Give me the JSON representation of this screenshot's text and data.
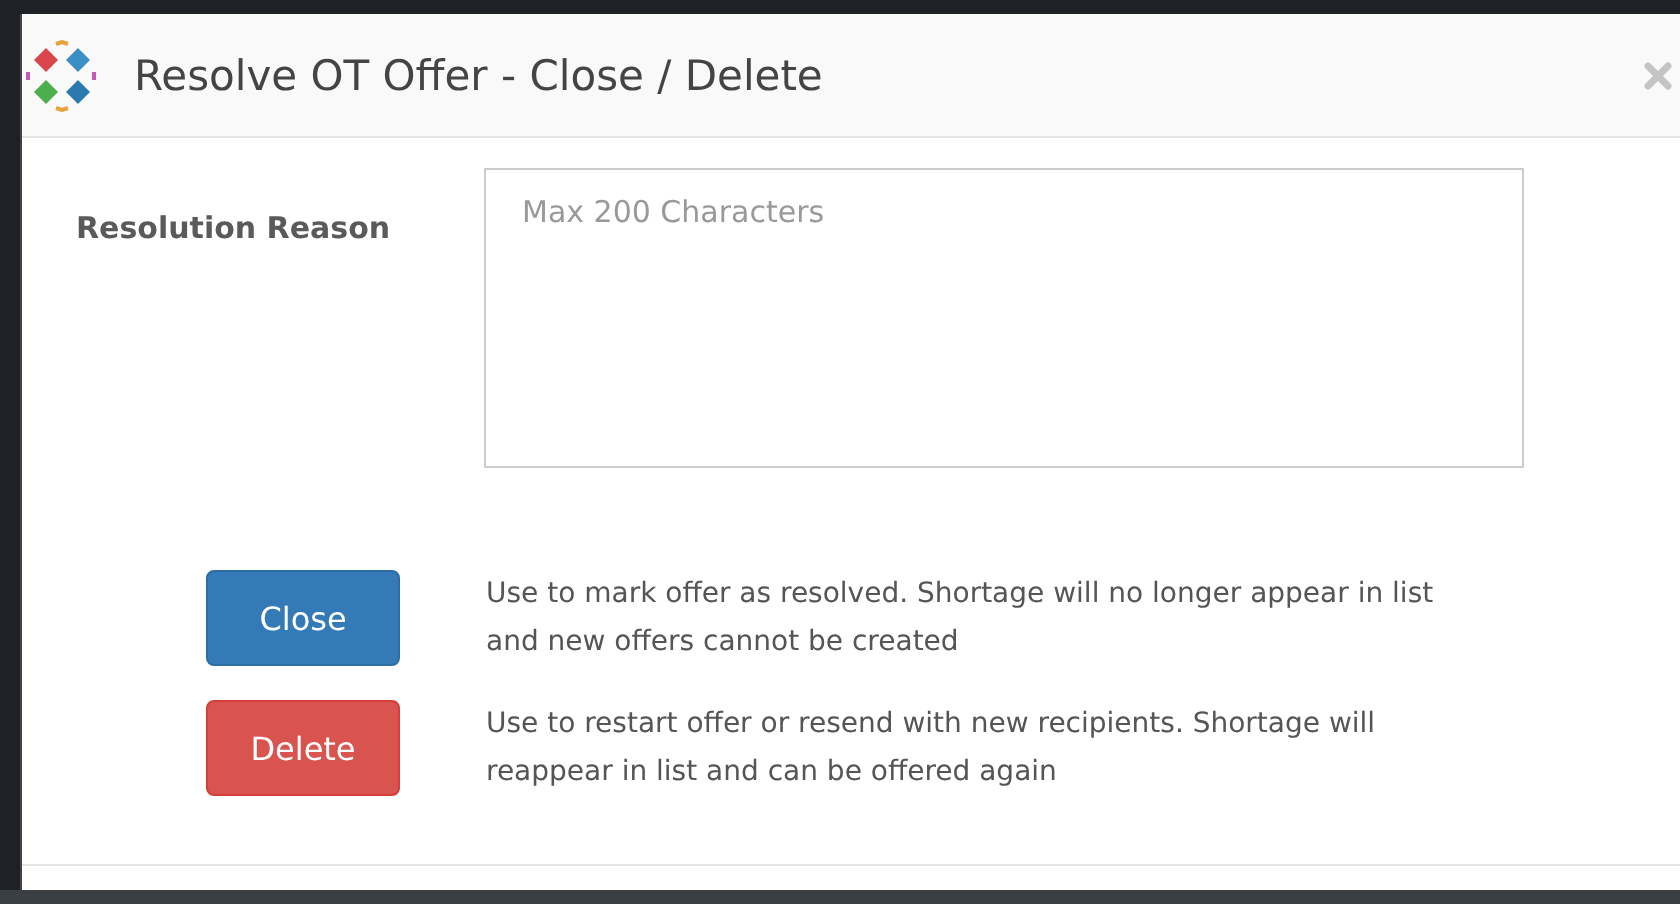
{
  "dialog": {
    "title": "Resolve OT Offer - Close / Delete"
  },
  "field": {
    "label": "Resolution Reason",
    "placeholder": "Max 200 Characters"
  },
  "actions": [
    {
      "kind": "primary",
      "label": "Close",
      "description": "Use to mark offer as resolved. Shortage will no longer appear in list and new offers cannot be created"
    },
    {
      "kind": "danger",
      "label": "Delete",
      "description": "Use to restart offer or resend with new recipients. Shortage will reappear in list and can be offered again"
    }
  ]
}
